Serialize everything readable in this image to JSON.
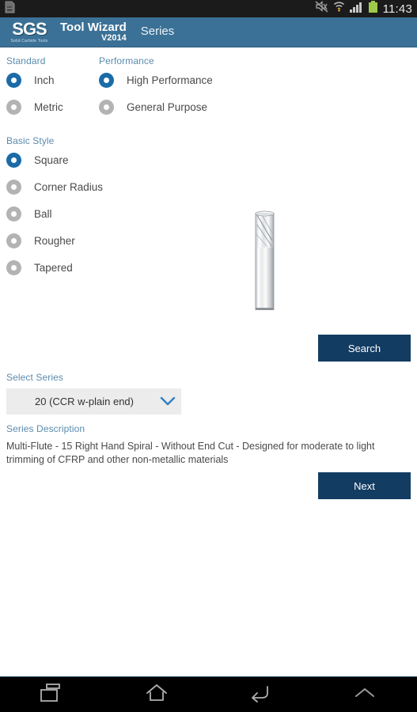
{
  "statusbar": {
    "clock": "11:43",
    "icons": {
      "sim": "sim-card-icon",
      "mute": "mute-icon",
      "wifi": "wifi-icon",
      "signal": "signal-bars-icon",
      "battery": "battery-icon"
    }
  },
  "header": {
    "logo_main": "SGS",
    "logo_sub": "Solid Carbide Tools",
    "app_title": "Tool Wizard",
    "app_version": "V2014",
    "page_title": "Series",
    "bar_color": "#3b7196"
  },
  "main": {
    "standard": {
      "label": "Standard",
      "options": [
        {
          "label": "Inch",
          "selected": true
        },
        {
          "label": "Metric",
          "selected": false
        }
      ]
    },
    "performance": {
      "label": "Performance",
      "options": [
        {
          "label": "High Performance",
          "selected": true
        },
        {
          "label": "General Purpose",
          "selected": false
        }
      ]
    },
    "basic_style": {
      "label": "Basic Style",
      "options": [
        {
          "label": "Square",
          "selected": true
        },
        {
          "label": "Corner Radius",
          "selected": false
        },
        {
          "label": "Ball",
          "selected": false
        },
        {
          "label": "Rougher",
          "selected": false
        },
        {
          "label": "Tapered",
          "selected": false
        }
      ]
    },
    "tool_image": "end-mill-tool-image",
    "search_button": "Search",
    "select_series": {
      "label": "Select Series",
      "value": "20 (CCR w-plain end)"
    },
    "series_description": {
      "label": "Series Description",
      "text": "Multi-Flute - 15 Right Hand Spiral - Without End Cut - Designed for moderate to light trimming of CFRP and other non-metallic materials"
    },
    "next_button": "Next",
    "accent_color": "#1a6ba8",
    "button_color": "#133c63",
    "label_color": "#5a8cae"
  },
  "navbar": {
    "recents": "recents-icon",
    "home": "home-icon",
    "back": "back-icon",
    "expand": "chevron-up-icon"
  }
}
